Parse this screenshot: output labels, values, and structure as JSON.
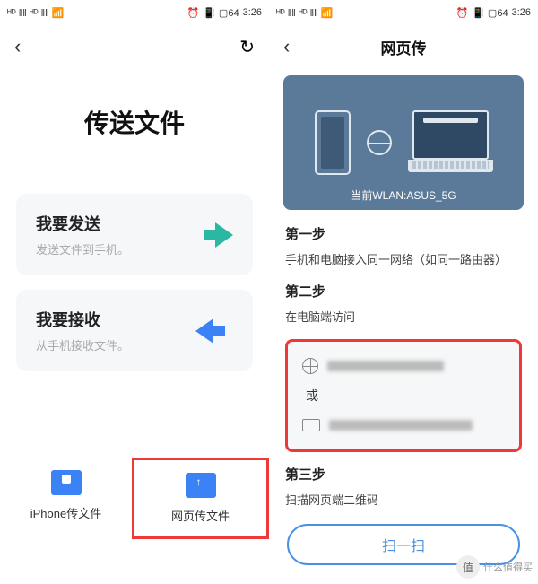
{
  "statusBar": {
    "signal": "📶",
    "wifi": "📶",
    "alarm": "⏰",
    "vibrate": "📳",
    "battery": "64",
    "time": "3:26"
  },
  "left": {
    "bigTitle": "传送文件",
    "send": {
      "title": "我要发送",
      "sub": "发送文件到手机。"
    },
    "receive": {
      "title": "我要接收",
      "sub": "从手机接收文件。"
    },
    "iphone": "iPhone传文件",
    "web": "网页传文件"
  },
  "right": {
    "title": "网页传",
    "wlan": "当前WLAN:ASUS_5G",
    "step1": {
      "title": "第一步",
      "text": "手机和电脑接入同一网络（如同一路由器）"
    },
    "step2": {
      "title": "第二步",
      "text": "在电脑端访问"
    },
    "or": "或",
    "step3": {
      "title": "第三步",
      "text": "扫描网页端二维码"
    },
    "scanBtn": "扫一扫"
  },
  "watermark": {
    "badge": "值",
    "text": "什么值得买"
  }
}
